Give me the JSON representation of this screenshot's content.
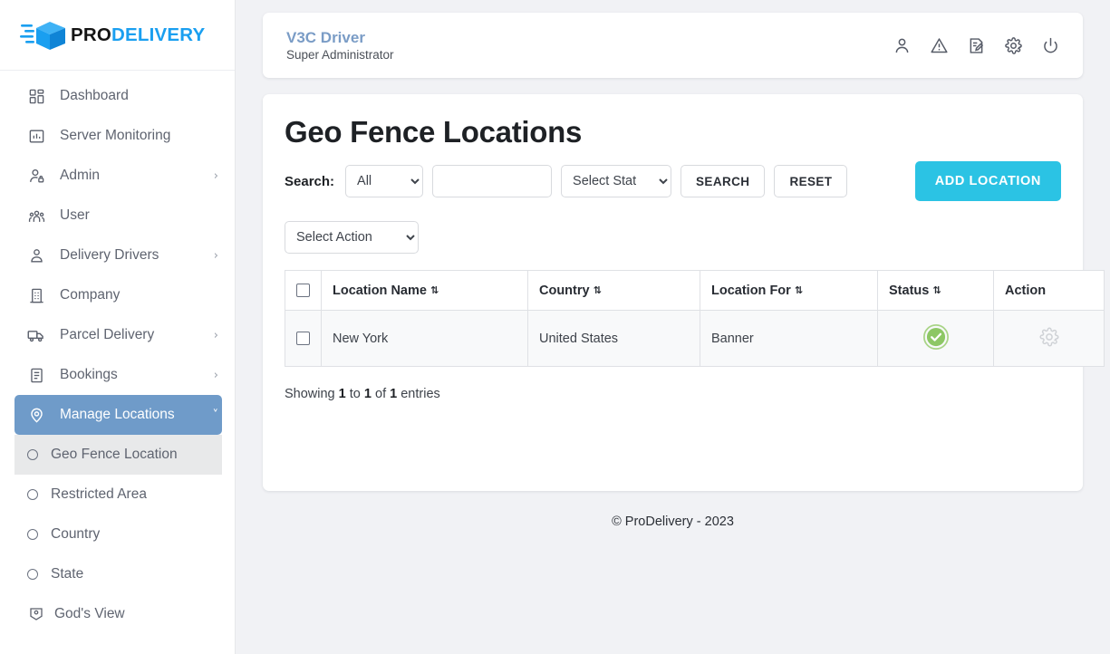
{
  "brand": {
    "logo_pro": "PRO",
    "logo_delivery": "DELIVERY",
    "logo_icon": "delivery-box-icon",
    "accent_blue": "#1a9ff0",
    "active_nav_blue": "#6f9bc9",
    "add_button_cyan": "#2bc3e4",
    "status_green": "#8dc765"
  },
  "sidebar": {
    "items": [
      {
        "label": "Dashboard",
        "icon": "dashboard-grid-icon",
        "caret": "",
        "active": false
      },
      {
        "label": "Server Monitoring",
        "icon": "chart-monitor-icon",
        "caret": "",
        "active": false
      },
      {
        "label": "Admin",
        "icon": "user-lock-icon",
        "caret": "›",
        "active": false
      },
      {
        "label": "User",
        "icon": "users-group-icon",
        "caret": "",
        "active": false
      },
      {
        "label": "Delivery Drivers",
        "icon": "driver-person-icon",
        "caret": "›",
        "active": false
      },
      {
        "label": "Company",
        "icon": "building-icon",
        "caret": "",
        "active": false
      },
      {
        "label": "Parcel Delivery",
        "icon": "truck-icon",
        "caret": "›",
        "active": false
      },
      {
        "label": "Bookings",
        "icon": "clipboard-list-icon",
        "caret": "›",
        "active": false
      },
      {
        "label": "Manage Locations",
        "icon": "map-pin-icon",
        "caret": "˅",
        "active": true
      }
    ],
    "sub_items": [
      {
        "label": "Geo Fence Location",
        "icon": "radio-circle-icon",
        "selected": true
      },
      {
        "label": "Restricted Area",
        "icon": "radio-circle-icon",
        "selected": false
      },
      {
        "label": "Country",
        "icon": "radio-circle-icon",
        "selected": false
      },
      {
        "label": "State",
        "icon": "radio-circle-icon",
        "selected": false
      },
      {
        "label": "God's View",
        "icon": "map-location-icon",
        "selected": false
      }
    ]
  },
  "topbar": {
    "user_name": "V3C Driver",
    "user_role": "Super Administrator",
    "icons": [
      {
        "name": "profile-icon"
      },
      {
        "name": "alert-triangle-icon"
      },
      {
        "name": "edit-document-icon"
      },
      {
        "name": "settings-gear-icon"
      },
      {
        "name": "power-logout-icon"
      }
    ]
  },
  "page": {
    "title": "Geo Fence Locations",
    "search_label": "Search:",
    "search_scope_value": "All",
    "search_scope_options": [
      "All"
    ],
    "search_text_value": "",
    "search_text_placeholder": "",
    "status_filter_value": "Select Status",
    "status_filter_options": [
      "Select Status"
    ],
    "search_button": "SEARCH",
    "reset_button": "RESET",
    "add_button": "ADD LOCATION",
    "bulk_action_value": "Select Action",
    "bulk_action_options": [
      "Select Action"
    ]
  },
  "table": {
    "select_all_checkbox": false,
    "columns": [
      {
        "key": "check",
        "label": "",
        "sortable": false
      },
      {
        "key": "name",
        "label": "Location Name",
        "sortable": true
      },
      {
        "key": "country",
        "label": "Country",
        "sortable": true
      },
      {
        "key": "for",
        "label": "Location For",
        "sortable": true
      },
      {
        "key": "status",
        "label": "Status",
        "sortable": true
      },
      {
        "key": "action",
        "label": "Action",
        "sortable": false
      }
    ],
    "sort_glyph": "⇅",
    "rows": [
      {
        "checked": false,
        "name": "New York",
        "country": "United States",
        "for": "Banner",
        "status": "active",
        "status_icon": "check-circle-icon",
        "action_icon": "settings-gear-icon"
      }
    ],
    "showing_prefix": "Showing",
    "showing_from": "1",
    "showing_mid": "to",
    "showing_to": "1",
    "showing_of": "of",
    "showing_total": "1",
    "showing_suffix": "entries"
  },
  "footer": {
    "text": "© ProDelivery - 2023"
  }
}
